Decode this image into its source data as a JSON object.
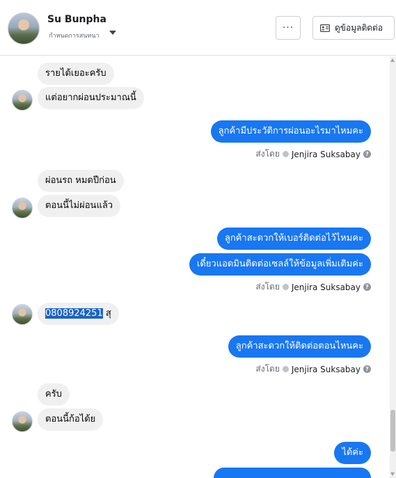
{
  "header": {
    "name": "Su Bunpha",
    "subtitle": "กำหนดการสนทนา",
    "more_label": "···",
    "contact_label": "ดูข้อมูลติดต่อ"
  },
  "messages": {
    "m1": "รายได้เยอะครับ",
    "m2": "แต่อยากผ่อนประมาณนี้",
    "m3": "ลูกค้ามีประวัติการผ่อนอะไรมาไหมคะ",
    "m4": "ผ่อนรถ หมดปีก่อน",
    "m5": "ตอนนี้ไม่ผ่อนแล้ว",
    "m6": "ลูกค้าสะดวกให้เบอร์ติดต่อไว้ไหมคะ",
    "m7": "เดี๋ยวแอดมินติดต่อเซลล์ให้ข้อมูลเพิ่มเติมค่ะ",
    "m8_phone": "0808924251",
    "m8_suffix": " สุ",
    "m9": "ลูกค้าสะดวกให้ติดต่อตอนไหนคะ",
    "m10": "ครับ",
    "m11": "ตอนนี้ก้อได้ย",
    "m12": "ได้ค่ะ"
  },
  "sent_by": {
    "prefix": "ส่งโดย",
    "agent": "Jenjira Suksabay",
    "info": "?"
  },
  "colors": {
    "outgoing": "#1877f2",
    "incoming": "#f0f0f0",
    "selection": "#1a63c6"
  }
}
